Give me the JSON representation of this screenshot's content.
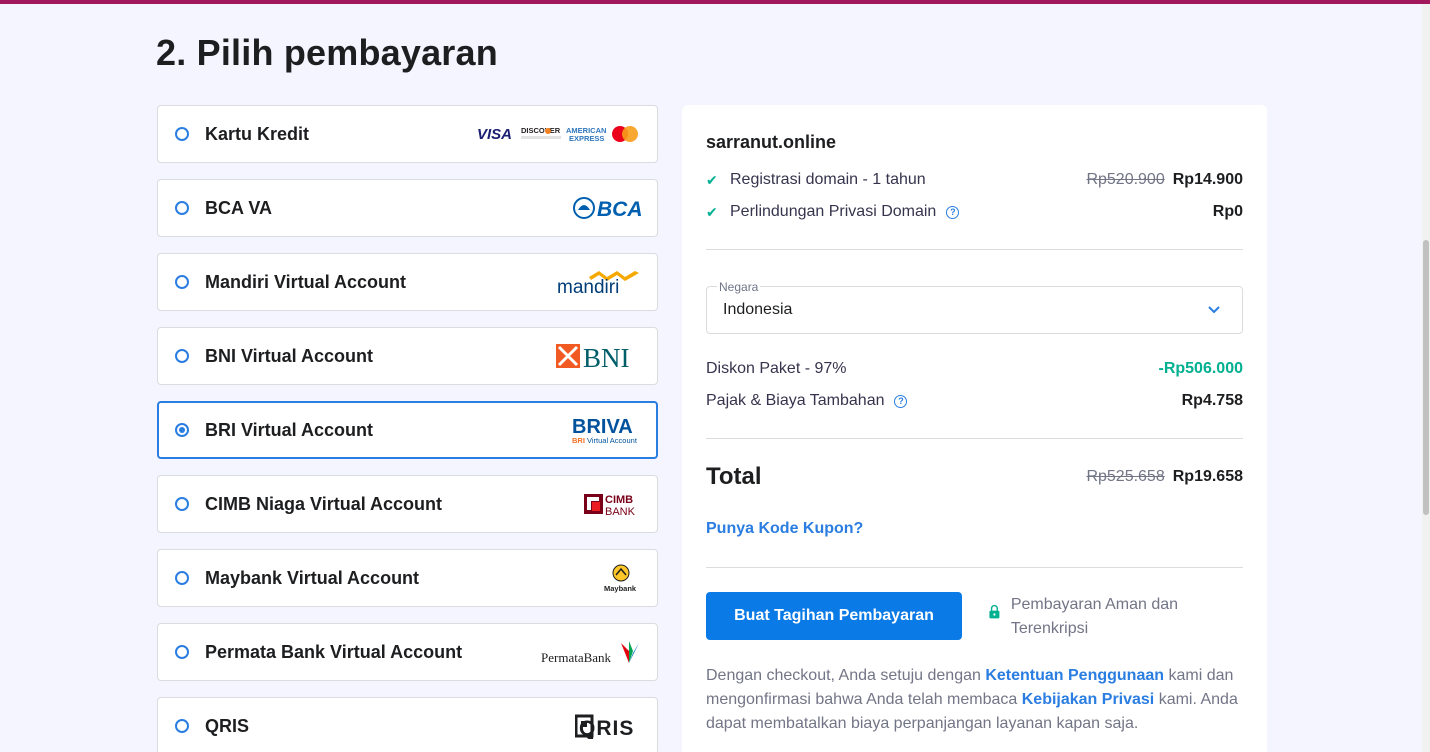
{
  "page": {
    "title": "2. Pilih pembayaran"
  },
  "methods": [
    {
      "label": "Kartu Kredit",
      "logo": "card-logos",
      "selected": false
    },
    {
      "label": "BCA VA",
      "logo": "bca-logo",
      "selected": false
    },
    {
      "label": "Mandiri Virtual Account",
      "logo": "mandiri-logo",
      "selected": false
    },
    {
      "label": "BNI Virtual Account",
      "logo": "bni-logo",
      "selected": false
    },
    {
      "label": "BRI Virtual Account",
      "logo": "briva-logo",
      "selected": true
    },
    {
      "label": "CIMB Niaga Virtual Account",
      "logo": "cimb-logo",
      "selected": false
    },
    {
      "label": "Maybank Virtual Account",
      "logo": "maybank-logo",
      "selected": false
    },
    {
      "label": "Permata Bank Virtual Account",
      "logo": "permata-logo",
      "selected": false
    },
    {
      "label": "QRIS",
      "logo": "qris-logo",
      "selected": false
    }
  ],
  "logos": {
    "visa": "VISA",
    "discover": "DISCOVER",
    "amex_1": "AMERICAN",
    "amex_2": "EXPRESS",
    "bca": "BCA",
    "mandiri": "mandiri",
    "bni": "BNI",
    "briva": "BRIVA",
    "briva_sub_1": "BRI",
    "briva_sub_2": " Virtual Account",
    "cimb_1": "CIMB",
    "cimb_2": "BANK",
    "maybank": "Maybank",
    "permata": "PermataBank",
    "qris": "QRIS"
  },
  "summary": {
    "domain": "sarranut.online",
    "items": [
      {
        "label": "Registrasi domain - 1 tahun",
        "old_price": "Rp520.900",
        "price": "Rp14.900"
      },
      {
        "label": "Perlindungan Privasi Domain",
        "price": "Rp0"
      }
    ],
    "country": {
      "label": "Negara",
      "value": "Indonesia"
    },
    "discount": {
      "label": "Diskon Paket - 97%",
      "value": "-Rp506.000"
    },
    "tax": {
      "label": "Pajak & Biaya Tambahan",
      "value": "Rp4.758"
    },
    "total": {
      "label": "Total",
      "old_price": "Rp525.658",
      "price": "Rp19.658"
    },
    "coupon": "Punya Kode Kupon?",
    "pay_button": "Buat Tagihan Pembayaran",
    "secure_text": "Pembayaran Aman dan Terenkripsi",
    "legal": {
      "part1": "Dengan checkout, Anda setuju dengan ",
      "link1": "Ketentuan Penggunaan",
      "part2": " kami dan mengonfirmasi bahwa Anda telah membaca ",
      "link2": "Kebijakan Privasi",
      "part3": " kami. Anda dapat membatalkan biaya perpanjangan layanan kapan saja."
    }
  },
  "colors": {
    "accent": "#2a7de1",
    "button": "#0a7ae6",
    "success": "#00b090",
    "topbar": "#a2185c"
  }
}
